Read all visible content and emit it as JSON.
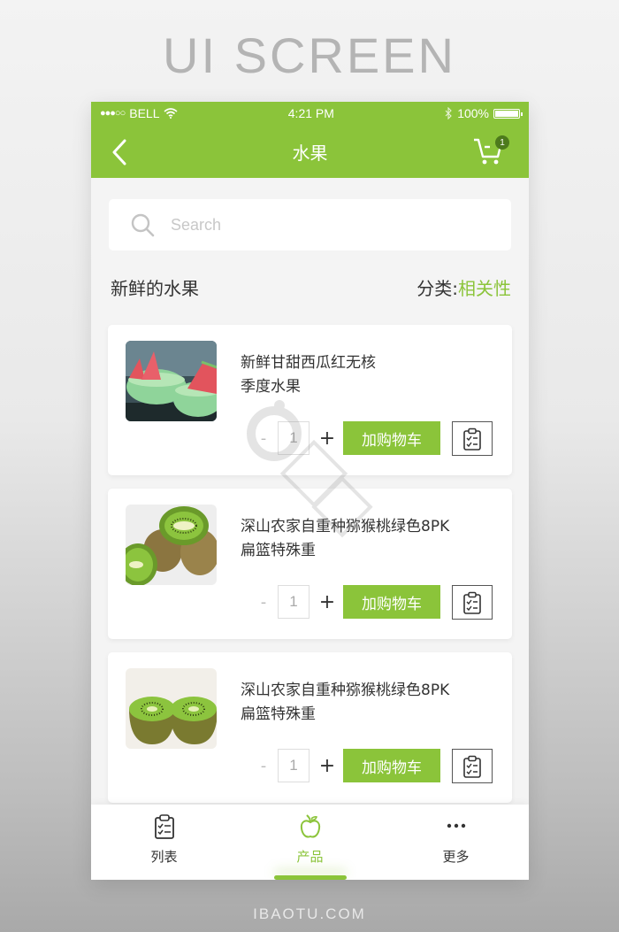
{
  "banner": {
    "title": "UI SCREEN",
    "footer": "IBAOTU.COM"
  },
  "status_bar": {
    "carrier": "BELL",
    "signal": "●●●○○",
    "time": "4:21 PM",
    "battery": "100%",
    "battery_level": 1.0
  },
  "nav": {
    "title": "水果",
    "back_icon": "chevron-left-icon",
    "cart_icon": "cart-icon",
    "cart_count": "1"
  },
  "search": {
    "placeholder": "Search",
    "value": ""
  },
  "section": {
    "title": "新鲜的水果",
    "sort_label": "分类:",
    "sort_value": "相关性"
  },
  "products": [
    {
      "name_line1": "新鲜甘甜西瓜红无核",
      "name_line2": "季度水果",
      "image": "watermelon",
      "quantity": "1",
      "minus": "-",
      "plus": "+",
      "add_label": "加购物车"
    },
    {
      "name_line1": "深山农家自重种猕猴桃绿色8PK",
      "name_line2": "扁篮特殊重",
      "image": "kiwi-whole",
      "quantity": "1",
      "minus": "-",
      "plus": "+",
      "add_label": "加购物车"
    },
    {
      "name_line1": "深山农家自重种猕猴桃绿色8PK",
      "name_line2": "扁篮特殊重",
      "image": "kiwi-halves",
      "quantity": "1",
      "minus": "-",
      "plus": "+",
      "add_label": "加购物车"
    }
  ],
  "tabbar": {
    "items": [
      {
        "label": "列表",
        "icon": "clipboard-icon",
        "active": false
      },
      {
        "label": "产品",
        "icon": "apple-icon",
        "active": true
      },
      {
        "label": "更多",
        "icon": "more-icon",
        "active": false
      }
    ]
  },
  "colors": {
    "accent": "#8bc43a",
    "badge": "#4d7a1c",
    "text": "#333333"
  }
}
